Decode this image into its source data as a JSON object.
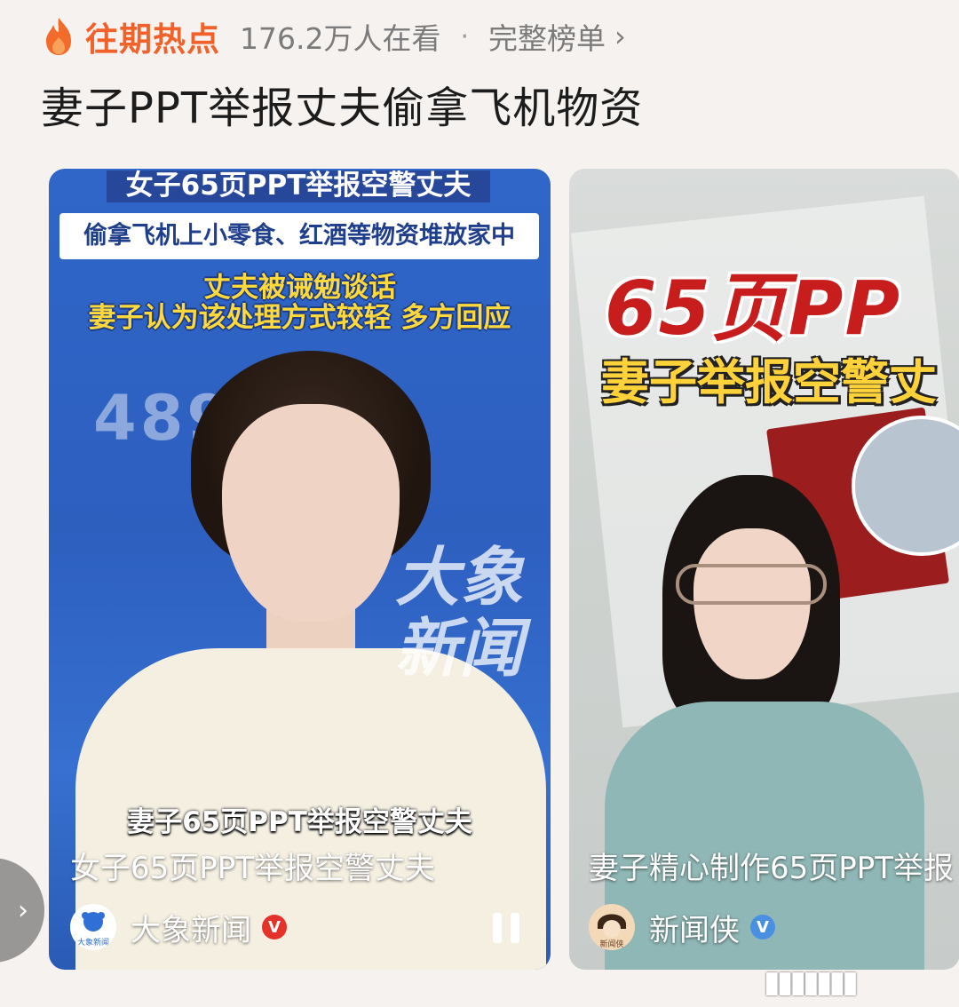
{
  "header": {
    "hot_label": "往期热点",
    "viewers": "176.2万人在看",
    "separator": "·",
    "full_list": "完整榜单",
    "chevron": "›"
  },
  "topic": {
    "title": "妻子PPT举报丈夫偷拿飞机物资"
  },
  "cards": [
    {
      "headline": "女子65页PPT举报空警丈夫",
      "subheadline": "偷拿飞机上小零食、红酒等物资堆放家中",
      "yellow_line_1": "丈夫被诫勉谈话",
      "yellow_line_2": "妻子认为该处理方式较轻 多方回应",
      "bg_digits": "489",
      "watermark_line_1": "大象",
      "watermark_line_2": "新闻",
      "caption": "妻子65页PPT举报空警丈夫",
      "title": "女子65页PPT举报空警丈夫",
      "author": "大象新闻",
      "avatar_text": "大象新闻",
      "badge": "V",
      "badge_color": "#e5312a"
    },
    {
      "overlay_big": "65页PP",
      "overlay_yellow": "妻子举报空警丈",
      "title": "妻子精心制作65页PPT举报",
      "author": "新闻侠",
      "avatar_text": "新闻侠",
      "badge": "V",
      "badge_color": "#4a90e2"
    }
  ],
  "side_button": {
    "icon": "chevron-right-icon",
    "glyph": "›"
  },
  "colors": {
    "accent": "#f0622a",
    "background": "#f6f2ef"
  }
}
